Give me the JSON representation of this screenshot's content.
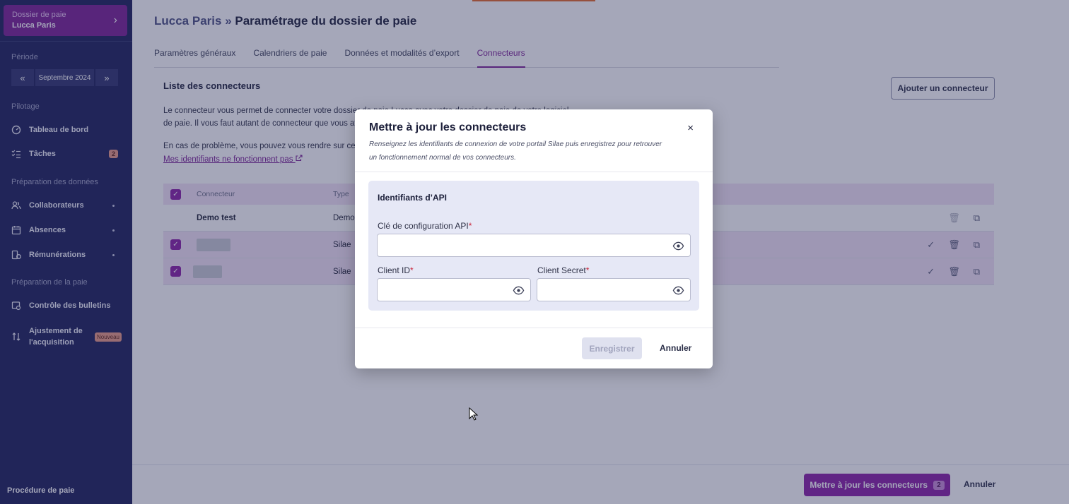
{
  "sidebar": {
    "dossier_label": "Dossier de paie",
    "dossier_name": "Lucca Paris",
    "section_period": "Période",
    "period_value": "Septembre 2024",
    "section_pilotage": "Pilotage",
    "dashboard": "Tableau de bord",
    "tasks": "Tâches",
    "tasks_count": "2",
    "section_prep_data": "Préparation des données",
    "collaborators": "Collaborateurs",
    "absences": "Absences",
    "remunerations": "Rémunérations",
    "section_prep_pay": "Préparation de la paie",
    "bulletins": "Contrôle des bulletins",
    "adjust_line1": "Ajustement de",
    "adjust_line2": "l'acquisition",
    "badge_new": "Nouveau",
    "procedure": "Procédure de paie"
  },
  "header": {
    "parent": "Lucca Paris",
    "separator": "»",
    "title": "Paramétrage du dossier de paie"
  },
  "tabs": [
    {
      "label": "Paramètres généraux"
    },
    {
      "label": "Calendriers de paie"
    },
    {
      "label": "Données et modalités d’export"
    },
    {
      "label": "Connecteurs"
    }
  ],
  "section": {
    "title": "Liste des connecteurs",
    "add_button": "Ajouter un connecteur",
    "para1_line1": "Le connecteur vous permet de connecter votre dossier de paie Lucca avec votre dossier de paie de votre logiciel",
    "para1_line2": "de paie. Il vous faut autant de connecteur que vous avez de dossiers",
    "para2": "En cas de problème, vous pouvez vous rendre sur ce",
    "link": "Mes identifiants ne fonctionnent pas"
  },
  "table": {
    "col_connector": "Connecteur",
    "col_type": "Type",
    "rows": [
      {
        "name": "Demo test",
        "type": "Demo"
      },
      {
        "name": "",
        "type": "Silae"
      },
      {
        "name": "",
        "type": "Silae"
      }
    ]
  },
  "footer": {
    "update_button": "Mettre à jour les connecteurs",
    "update_count": "2",
    "cancel": "Annuler"
  },
  "modal": {
    "title": "Mettre à jour les connecteurs",
    "close": "×",
    "subtitle_line1": "Renseignez les identifiants de connexion de votre portail Silae puis enregistrez pour retrouver",
    "subtitle_line2": "un fonctionnement normal de vos connecteurs.",
    "box_title": "Identifiants d’API",
    "api_key_label": "Clé de configuration API",
    "client_id_label": "Client ID",
    "client_secret_label": "Client Secret",
    "required_mark": "*",
    "save": "Enregistrer",
    "cancel": "Annuler"
  },
  "colors": {
    "sidebar_bg": "#1c1f5a",
    "brand_purple": "#8a1fa6",
    "overlay": "rgba(40,46,88,0.42)"
  }
}
